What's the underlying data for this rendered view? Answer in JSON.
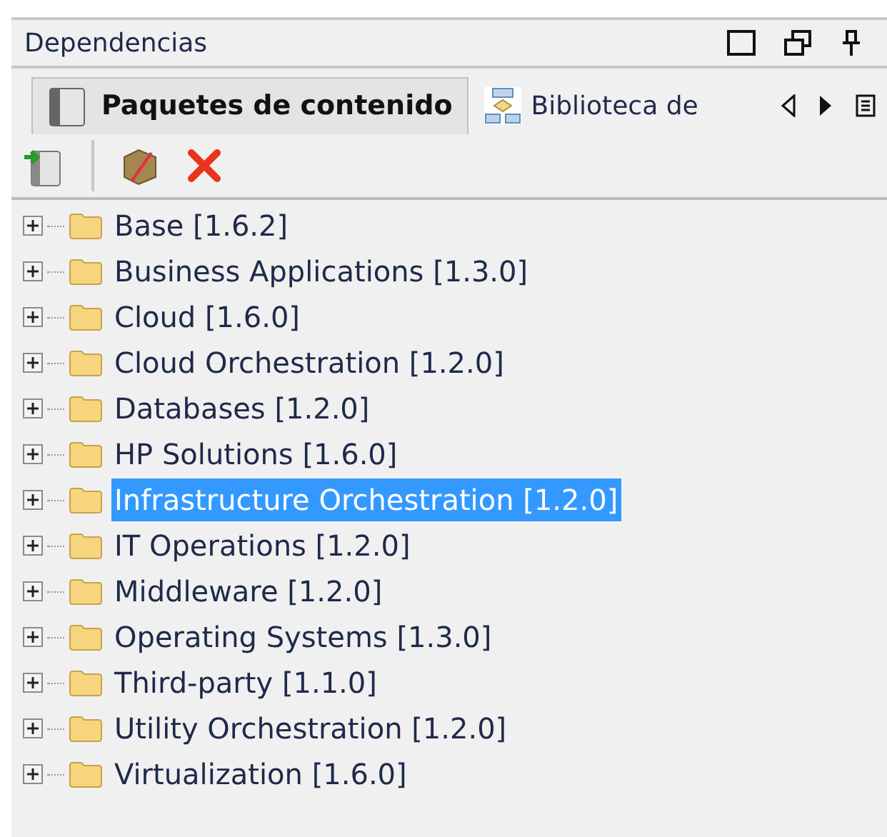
{
  "panel": {
    "title": "Dependencias"
  },
  "tabs": [
    {
      "label": "Paquetes de contenido",
      "selected": true,
      "kind": "package"
    },
    {
      "label": "Biblioteca de",
      "selected": false,
      "kind": "library"
    }
  ],
  "tree": [
    {
      "label": "Base [1.6.2]",
      "expanded": false,
      "selected": false
    },
    {
      "label": "Business Applications [1.3.0]",
      "expanded": false,
      "selected": false
    },
    {
      "label": "Cloud [1.6.0]",
      "expanded": false,
      "selected": false
    },
    {
      "label": "Cloud Orchestration [1.2.0]",
      "expanded": false,
      "selected": false
    },
    {
      "label": "Databases [1.2.0]",
      "expanded": false,
      "selected": false
    },
    {
      "label": "HP Solutions [1.6.0]",
      "expanded": false,
      "selected": false
    },
    {
      "label": "Infrastructure Orchestration [1.2.0]",
      "expanded": false,
      "selected": true
    },
    {
      "label": "IT Operations [1.2.0]",
      "expanded": false,
      "selected": false
    },
    {
      "label": "Middleware [1.2.0]",
      "expanded": false,
      "selected": false
    },
    {
      "label": "Operating Systems [1.3.0]",
      "expanded": false,
      "selected": false
    },
    {
      "label": "Third-party [1.1.0]",
      "expanded": false,
      "selected": false
    },
    {
      "label": "Utility Orchestration [1.2.0]",
      "expanded": false,
      "selected": false
    },
    {
      "label": "Virtualization [1.6.0]",
      "expanded": false,
      "selected": false
    }
  ]
}
